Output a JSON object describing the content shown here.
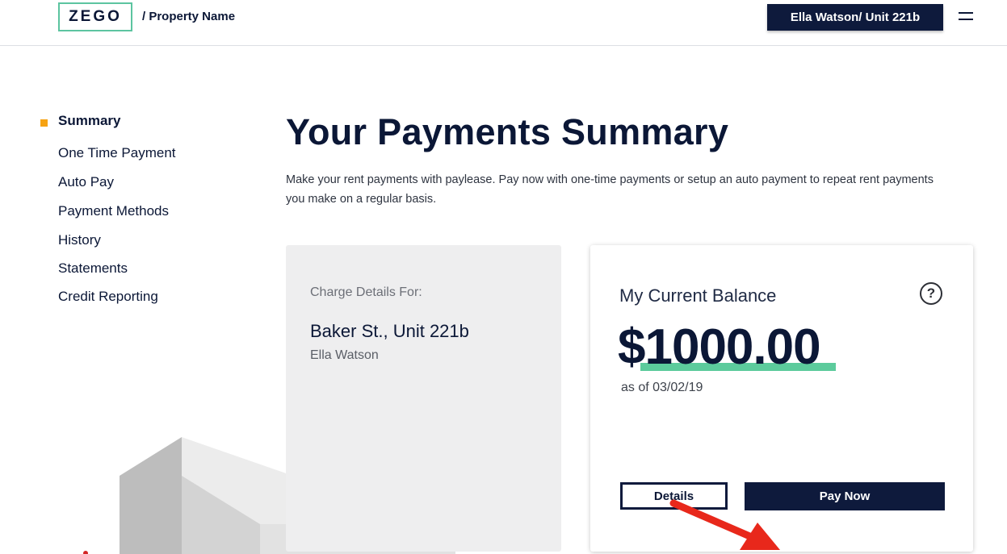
{
  "header": {
    "logo_text": "ZEGO",
    "breadcrumb": "/ Property Name",
    "user_button": "Ella Watson/ Unit 221b",
    "menu_icon": "hamburger-menu-icon"
  },
  "sidebar": {
    "items": [
      {
        "label": "Summary",
        "active": true
      },
      {
        "label": "One Time Payment",
        "active": false
      },
      {
        "label": "Auto Pay",
        "active": false
      },
      {
        "label": "Payment Methods",
        "active": false
      },
      {
        "label": "History",
        "active": false
      },
      {
        "label": "Statements",
        "active": false
      },
      {
        "label": "Credit Reporting",
        "active": false
      }
    ],
    "active_marker_color": "#f6a313"
  },
  "main": {
    "title": "Your Payments Summary",
    "description": "Make  your rent payments with paylease. Pay now with one-time payments or setup an auto payment to repeat rent payments you make on a regular basis."
  },
  "charge_card": {
    "label": "Charge Details For:",
    "address": "Baker St., Unit 221b",
    "resident": "Ella Watson"
  },
  "balance_card": {
    "label": "My Current Balance",
    "help_icon_text": "?",
    "amount": "$1000.00",
    "as_of": "as of 03/02/19",
    "details_button": "Details",
    "pay_now_button": "Pay Now"
  },
  "colors": {
    "brand_navy": "#0e1a3c",
    "accent_green": "#5ccb9c",
    "accent_orange": "#f6a313",
    "annotation_red": "#e8281b"
  }
}
